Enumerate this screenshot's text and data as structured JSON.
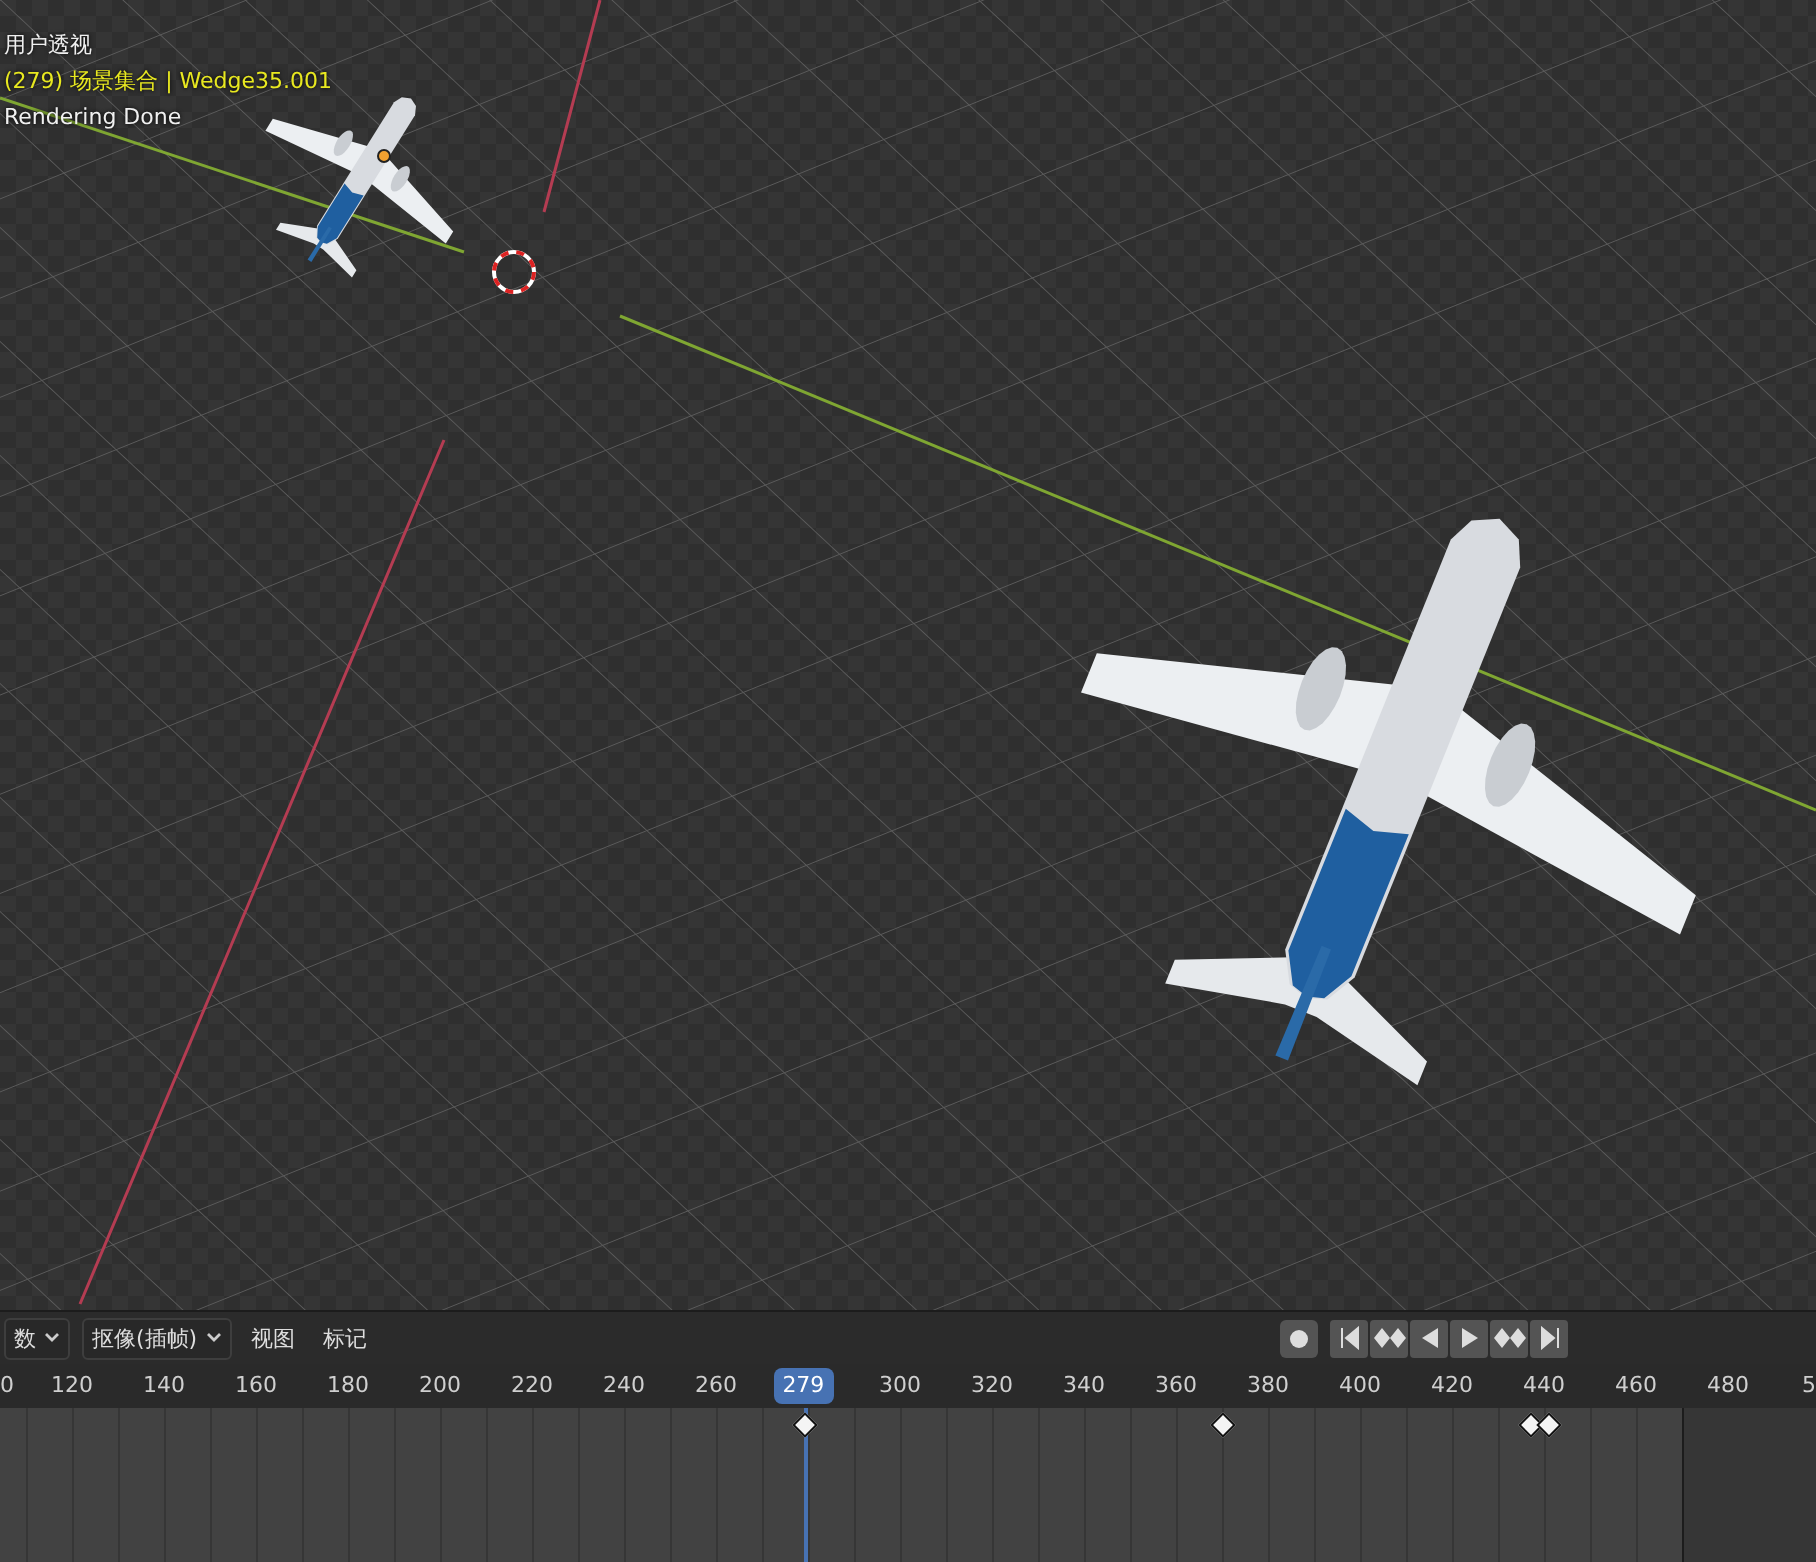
{
  "viewport": {
    "view_name": "用户透视",
    "object_info": "(279) 场景集合 | Wedge35.001",
    "status": "Rendering Done"
  },
  "timeline_header": {
    "menus": [
      {
        "label": "数",
        "kind": "dropdown"
      },
      {
        "label": "抠像(插帧)",
        "kind": "dropdown"
      },
      {
        "label": "视图",
        "kind": "menu"
      },
      {
        "label": "标记",
        "kind": "menu"
      }
    ]
  },
  "ruler": {
    "current_frame": "279",
    "labels": [
      "0",
      "120",
      "140",
      "160",
      "180",
      "200",
      "220",
      "240",
      "260",
      "300",
      "320",
      "340",
      "360",
      "380",
      "400",
      "420",
      "440",
      "460",
      "480",
      "5"
    ]
  }
}
